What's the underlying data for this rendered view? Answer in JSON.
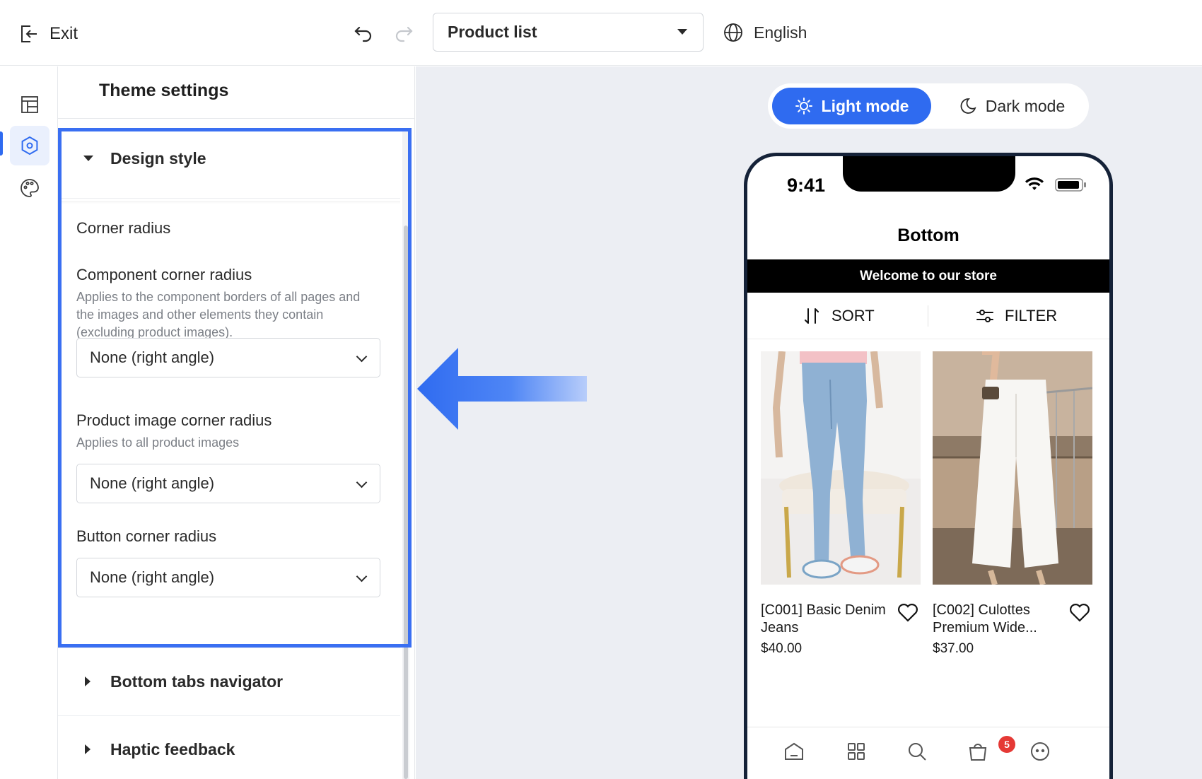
{
  "topbar": {
    "exit_label": "Exit",
    "page_select": {
      "value": "Product list"
    },
    "language": "English"
  },
  "rail": {
    "items": [
      {
        "icon": "layout-icon",
        "active": false
      },
      {
        "icon": "hexagon-settings-icon",
        "active": true
      },
      {
        "icon": "palette-icon",
        "active": false
      }
    ]
  },
  "panel": {
    "title": "Theme settings",
    "design_style": {
      "label": "Design style",
      "expanded": true,
      "group_title": "Corner radius",
      "fields": [
        {
          "label": "Component corner radius",
          "help": "Applies to the component borders of all pages and the images and other elements they contain (excluding product images).",
          "value": "None (right angle)"
        },
        {
          "label": "Product image corner radius",
          "help": "Applies to all product images",
          "value": "None (right angle)"
        },
        {
          "label": "Button corner radius",
          "help": "",
          "value": "None (right angle)"
        }
      ]
    },
    "collapsed_sections": [
      {
        "label": "Bottom tabs navigator"
      },
      {
        "label": "Haptic feedback"
      }
    ]
  },
  "preview": {
    "modes": {
      "light": "Light mode",
      "dark": "Dark mode",
      "selected": "light"
    },
    "phone": {
      "time": "9:41",
      "title": "Bottom",
      "banner": "Welcome to our store",
      "sort_label": "SORT",
      "filter_label": "FILTER",
      "products": [
        {
          "name": "[C001] Basic Denim Jeans",
          "price": "$40.00"
        },
        {
          "name": "[C002] Culottes Premium Wide...",
          "price": "$37.00"
        }
      ],
      "tabs": [
        "home-icon",
        "grid-icon",
        "search-icon",
        "bag-icon",
        "more-icon"
      ],
      "cart_badge": "5"
    }
  },
  "colors": {
    "accent": "#2f6bf0",
    "highlight_border": "#3a6ff2",
    "preview_bg": "#eceef3",
    "badge": "#e53935"
  }
}
